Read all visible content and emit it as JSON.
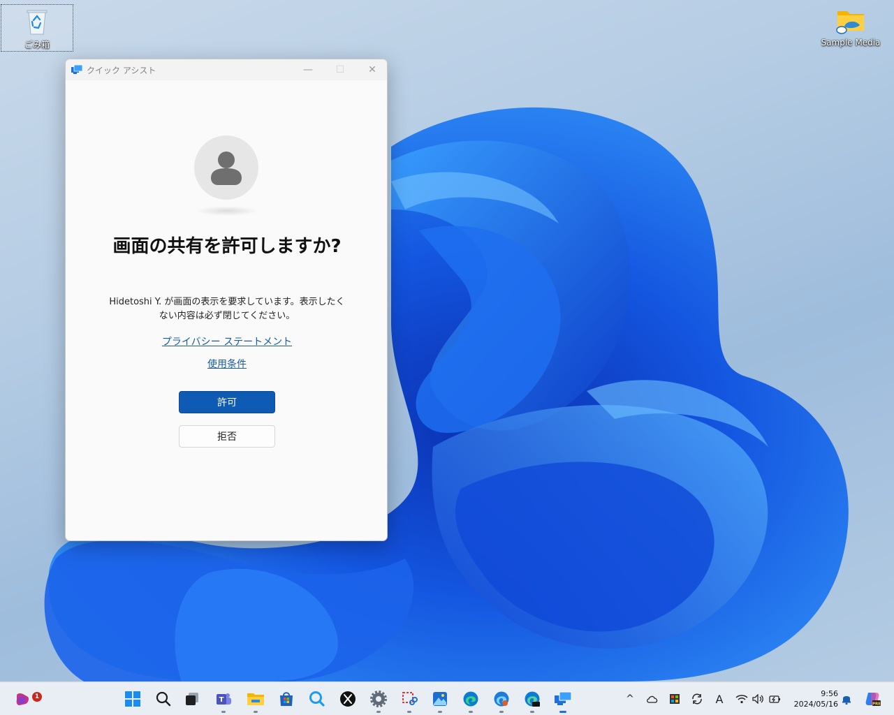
{
  "desktop": {
    "icons": [
      {
        "label": "ごみ箱",
        "icon": "recycle-bin-icon"
      },
      {
        "label": "Sample Media",
        "icon": "folder-cloud-icon"
      }
    ]
  },
  "window": {
    "title": "クイック アシスト",
    "app_icon": "quick-assist-icon",
    "controls": {
      "minimize": "—",
      "maximize": "☐",
      "close": "✕"
    },
    "heading": "画面の共有を許可しますか?",
    "description": "Hidetoshi Y. が画面の表示を要求しています。表示したくない内容は必ず閉じてください。",
    "privacy_link": "プライバシー ステートメント",
    "terms_link": "使用条件",
    "allow_button": "許可",
    "deny_button": "拒否",
    "accent_color": "#0f5bb3"
  },
  "taskbar": {
    "widgets_badge": "1",
    "apps": [
      "widgets-icon",
      "start-icon",
      "search-icon",
      "task-view-icon",
      "teams-icon",
      "file-explorer-icon",
      "store-icon",
      "search-app-icon",
      "x-icon",
      "settings-icon",
      "snipping-tool-icon",
      "photos-icon",
      "edge-icon",
      "edge-beta-icon",
      "edge-dev-icon",
      "quick-assist-icon"
    ],
    "tray": {
      "chevron": "^",
      "ime": "A",
      "time": "9:56",
      "date": "2024/05/16"
    }
  }
}
